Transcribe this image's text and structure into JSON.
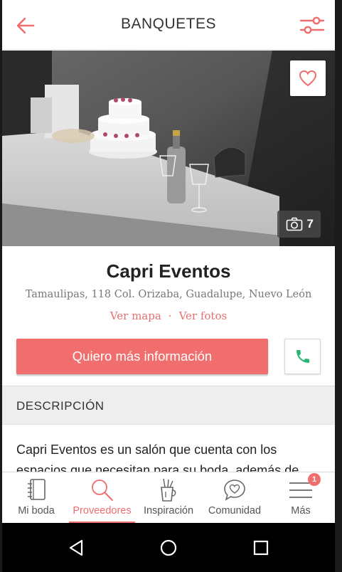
{
  "appbar": {
    "title": "BANQUETES",
    "back_icon": "arrow-left-icon",
    "filter_icon": "sliders-icon",
    "accent": "#f06e6d"
  },
  "hero": {
    "favorite_icon": "heart-outline-icon",
    "photo_count": "7",
    "camera_icon": "camera-icon"
  },
  "vendor": {
    "name": "Capri Eventos",
    "address": "Tamaulipas, 118 Col. Orizaba, Guadalupe, Nuevo León",
    "map_link": "Ver mapa",
    "separator": "·",
    "photos_link": "Ver fotos",
    "info_button": "Quiero más información",
    "phone_icon": "phone-icon",
    "phone_color": "#2bb573"
  },
  "description": {
    "header": "DESCRIPCIÓN",
    "text": "Capri Eventos es un salón que cuenta con los espacios que necesitan para su boda, además de que les"
  },
  "bottom_nav": {
    "items": [
      {
        "label": "Mi boda",
        "icon": "notebook-icon"
      },
      {
        "label": "Proveedores",
        "icon": "search-icon",
        "active": true
      },
      {
        "label": "Inspiración",
        "icon": "cup-pencils-icon"
      },
      {
        "label": "Comunidad",
        "icon": "chat-heart-icon"
      },
      {
        "label": "Más",
        "icon": "menu-icon",
        "badge": "1"
      }
    ]
  },
  "system_nav": {
    "back": "triangle-back-icon",
    "home": "circle-home-icon",
    "recents": "square-recents-icon"
  }
}
